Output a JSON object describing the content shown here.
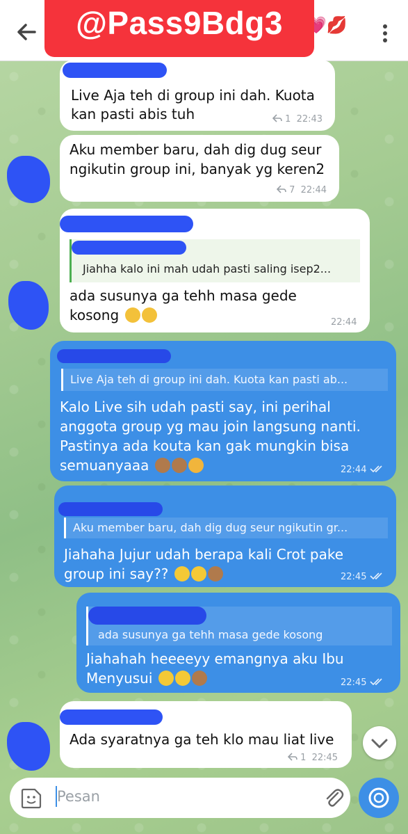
{
  "header": {
    "overlay_text": "@Pass9Bdg3",
    "emoji_text": "💗💋"
  },
  "messages": [
    {
      "text_1": "Live Aja teh di group ini dah. Kuota",
      "text_2": "kan pasti abis tuh",
      "replies": "1",
      "time": "22:43"
    },
    {
      "text_1": "Aku member baru, dah dig dug seur",
      "text_2": "ngikutin group ini, banyak yg keren2",
      "replies": "7",
      "time": "22:44"
    },
    {
      "quote": "Jiahha kalo ini mah udah pasti saling isep2...",
      "text_1": "ada susunya ga tehh masa gede",
      "text_2": "kosong",
      "time": "22:44"
    },
    {
      "quote": "Live Aja teh di group ini dah. Kuota kan pasti ab...",
      "text_1": "Kalo Live sih udah pasti say, ini perihal",
      "text_2": "anggota group yg mau join langsung nanti.",
      "text_3": "Pastinya ada kouta kan gak mungkin bisa",
      "text_4": "semuanyaaa",
      "time": "22:44"
    },
    {
      "quote": "Aku member baru, dah dig dug seur ngikutin gr...",
      "text_1": "Jiahaha Jujur udah berapa kali Crot pake",
      "text_2": "group ini say??",
      "time": "22:45"
    },
    {
      "quote": "ada susunya ga tehh masa gede kosong",
      "text_1": "Jiahahah heeeeyy emangnya aku Ibu",
      "text_2": "Menyusui",
      "time": "22:45"
    },
    {
      "text_1": "Ada syaratnya ga teh klo mau liat live",
      "replies": "1",
      "time": "22:45"
    }
  ],
  "input": {
    "placeholder": "Pesan"
  },
  "colors": {
    "outgoing": "#3d8fe6",
    "incoming": "#ffffff",
    "banner": "#f5333b",
    "redaction": "#2e53f5"
  },
  "icons": [
    "back-arrow-icon",
    "kebab-menu-icon",
    "sticker-icon",
    "attach-icon",
    "camera-icon",
    "chevron-down-icon",
    "double-check-icon",
    "reply-icon"
  ]
}
